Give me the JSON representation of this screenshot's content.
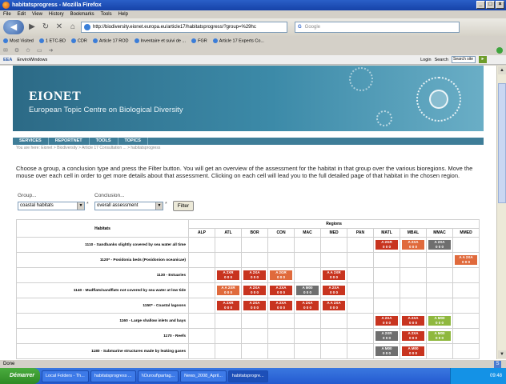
{
  "window": {
    "title": "habitatsprogress - Mozilla Firefox",
    "controls": [
      "_",
      "□",
      "×"
    ]
  },
  "menu": [
    "File",
    "Edit",
    "View",
    "History",
    "Bookmarks",
    "Tools",
    "Help"
  ],
  "nav": {
    "url": "http://biodiversity.eionet.europa.eu/article17/habitatsprogress/?group=%29hc",
    "search_placeholder": "Google"
  },
  "bookmarks": [
    "Most Visited",
    "1 ETC-BD",
    "CDR",
    "Article 17 ROD",
    "Inventaire et suivi de ...",
    "FGR",
    "Article 17 Experts Co..."
  ],
  "eea_toolbar": {
    "brand": "EEA",
    "portal": "EnviroWindows",
    "login": "Login",
    "search_label": "Search",
    "search_value": "Search site"
  },
  "banner": {
    "title": "EIONET",
    "subtitle": "European Topic Centre on Biological Diversity"
  },
  "tabs": [
    "SERVICES",
    "REPORTNET",
    "TOOLS",
    "TOPICS"
  ],
  "breadcrumb": "You are here: Eionet > Biodiversity > Article 17 Consultation ... > habitatsprogress",
  "intro": "Choose a group, a conclusion type and press the Filter button. You will get an overview of the assessment for the habitat in that group over the various bioregions. Move the mouse over each cell in order to get more details about that assessment. Clicking on each cell will lead you to the full detailed page of that habitat in the chosen region.",
  "filters": {
    "group_label": "Group...",
    "group_value": "coastal habitats",
    "conclusion_label": "Conclusion...",
    "conclusion_value": "overall assessment",
    "filter_button": "Filter",
    "required_marker": "*"
  },
  "table": {
    "habitats_header": "Habitats",
    "regions_header": "Regions",
    "regions": [
      "ALP",
      "ATL",
      "BOR",
      "CON",
      "MAC",
      "MED",
      "PAN",
      "MATL",
      "MBAL",
      "MMAC",
      "MMED"
    ],
    "rows": [
      {
        "name": "1110 - Sandbanks slightly covered by sea water all time",
        "cells": {
          "MATL": [
            "A 2GR",
            "red"
          ],
          "MBAL": [
            "A 2XA",
            "orange"
          ],
          "MMAC": [
            "A 2XA",
            "grey"
          ]
        }
      },
      {
        "name": "1120* - Posidonia beds (Posidonion oceanicae)",
        "cells": {
          "MMED": [
            "A A 2XA",
            "orange"
          ]
        }
      },
      {
        "name": "1130 - Estuaries",
        "cells": {
          "ATL": [
            "A 2XR",
            "red"
          ],
          "BOR": [
            "A 2XA",
            "red"
          ],
          "CON": [
            "A 2GR",
            "orange"
          ],
          "MED": [
            "A A 2XR",
            "red"
          ]
        }
      },
      {
        "name": "1140 - Mudflats/sandflats not covered by sea water at low tide",
        "cells": {
          "ATL": [
            "A A 2XR",
            "orange"
          ],
          "BOR": [
            "A 2XA",
            "red"
          ],
          "CON": [
            "A 2XA",
            "red"
          ],
          "MAC": [
            "A M00",
            "grey"
          ],
          "MED": [
            "A 2XA",
            "red"
          ]
        }
      },
      {
        "name": "1150* - Coastal lagoons",
        "cells": {
          "ATL": [
            "A 2XR",
            "red"
          ],
          "BOR": [
            "A 2XA",
            "red"
          ],
          "CON": [
            "A 2XA",
            "red"
          ],
          "MAC": [
            "A 2XA",
            "red"
          ],
          "MED": [
            "A A 2XA",
            "red"
          ]
        }
      },
      {
        "name": "1160 - Large shallow inlets and bays",
        "cells": {
          "MATL": [
            "A 2XA",
            "red"
          ],
          "MBAL": [
            "A 2XA",
            "red"
          ],
          "MMAC": [
            "A M00",
            "green"
          ]
        }
      },
      {
        "name": "1170 - Reefs",
        "cells": {
          "MATL": [
            "A 2XR",
            "grey"
          ],
          "MBAL": [
            "A 2XA",
            "red"
          ],
          "MMAC": [
            "A M00",
            "green"
          ]
        }
      },
      {
        "name": "1180 - Submarine structures made by leaking gases",
        "cells": {
          "MATL": [
            "A M00",
            "grey"
          ],
          "MBAL": [
            "A M00",
            "red"
          ]
        }
      }
    ],
    "cell_sub": "0 0 0"
  },
  "status": "Done",
  "taskbar": {
    "start": "Démarrer",
    "items": [
      "Local Folders - Th...",
      "habitatsprogress ...",
      "\\\\Ourouf\\partag...",
      "News_2008_April...",
      "habitatsprogre..."
    ],
    "clock": "09:48"
  },
  "colors": {
    "red": "#c8341f",
    "orange": "#e06a3c",
    "grey": "#6f6f6f",
    "green": "#8fb83e"
  }
}
